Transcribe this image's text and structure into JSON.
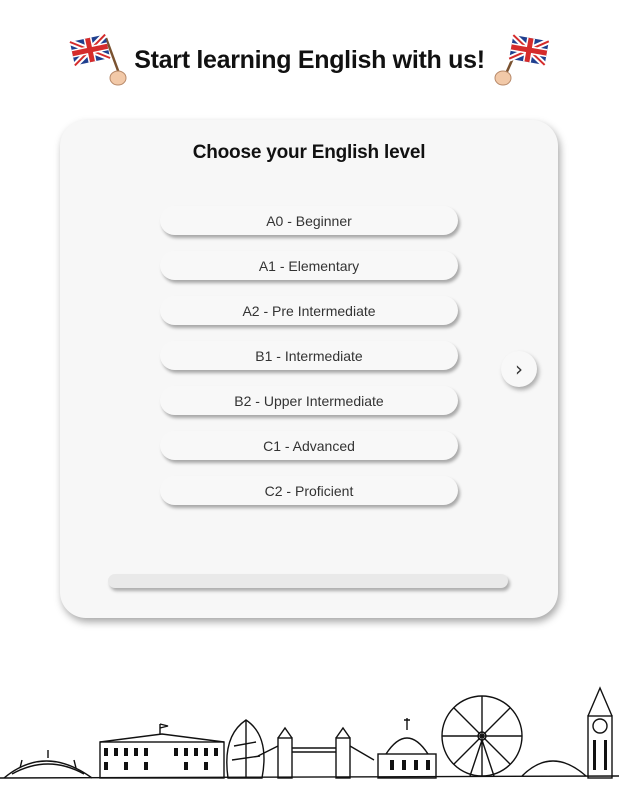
{
  "header": {
    "title": "Start learning English with us!",
    "flag_icon": "uk-flag-in-hand-icon"
  },
  "card": {
    "title": "Choose your English level",
    "levels": [
      "A0 - Beginner",
      "A1 - Elementary",
      "A2 - Pre Intermediate",
      "B1 - Intermediate",
      "B2 - Upper Intermediate",
      "C1 - Advanced",
      "C2 - Proficient"
    ],
    "next_label": "›",
    "progress": 0
  },
  "footer": {
    "illustration": "london-skyline-icon"
  },
  "colors": {
    "background": "#ffffff",
    "card": "#f7f7f7",
    "text": "#111111",
    "flag_blue": "#1f3f8f",
    "flag_red": "#d52b2b"
  }
}
